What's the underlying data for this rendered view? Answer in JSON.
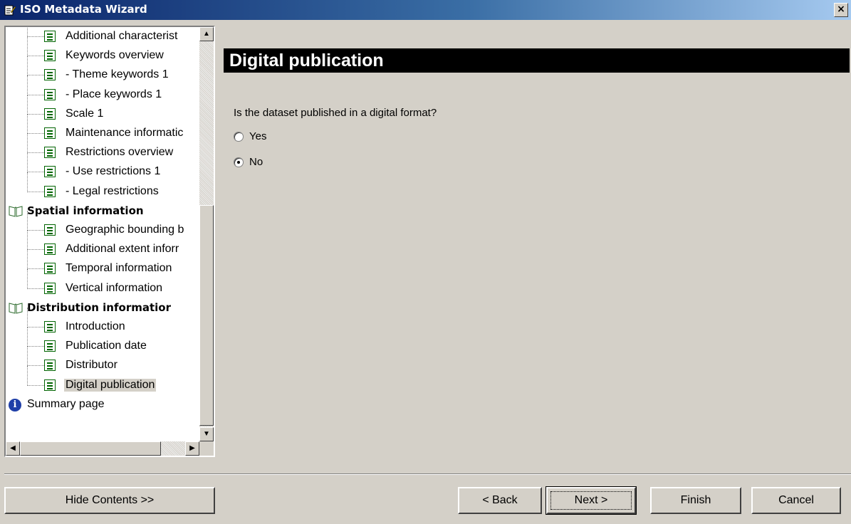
{
  "window": {
    "title": "ISO Metadata Wizard",
    "close_glyph": "×"
  },
  "tree": {
    "items": [
      {
        "type": "page",
        "label": "Additional characterist"
      },
      {
        "type": "page",
        "label": "Keywords overview"
      },
      {
        "type": "page",
        "label": "- Theme keywords 1"
      },
      {
        "type": "page",
        "label": "- Place keywords 1"
      },
      {
        "type": "page",
        "label": "Scale 1"
      },
      {
        "type": "page",
        "label": "Maintenance informatic"
      },
      {
        "type": "page",
        "label": "Restrictions overview"
      },
      {
        "type": "page",
        "label": "- Use restrictions 1"
      },
      {
        "type": "page",
        "label": "- Legal restrictions"
      },
      {
        "type": "folder",
        "label": "Spatial information"
      },
      {
        "type": "page",
        "label": "Geographic bounding b"
      },
      {
        "type": "page",
        "label": "Additional extent inforr"
      },
      {
        "type": "page",
        "label": "Temporal information"
      },
      {
        "type": "page",
        "label": "Vertical information"
      },
      {
        "type": "folder",
        "label": "Distribution informatior"
      },
      {
        "type": "page",
        "label": "Introduction"
      },
      {
        "type": "page",
        "label": "Publication date"
      },
      {
        "type": "page",
        "label": "Distributor"
      },
      {
        "type": "page",
        "label": "Digital publication",
        "selected": true
      },
      {
        "type": "info",
        "label": "Summary page"
      }
    ]
  },
  "main": {
    "heading": "Digital publication",
    "question": "Is the dataset published in a digital format?",
    "options": [
      {
        "label": "Yes",
        "checked": false
      },
      {
        "label": "No",
        "checked": true
      }
    ]
  },
  "buttons": {
    "hide_contents": "Hide Contents >>",
    "back": "< Back",
    "next": "Next >",
    "finish": "Finish",
    "cancel": "Cancel"
  }
}
